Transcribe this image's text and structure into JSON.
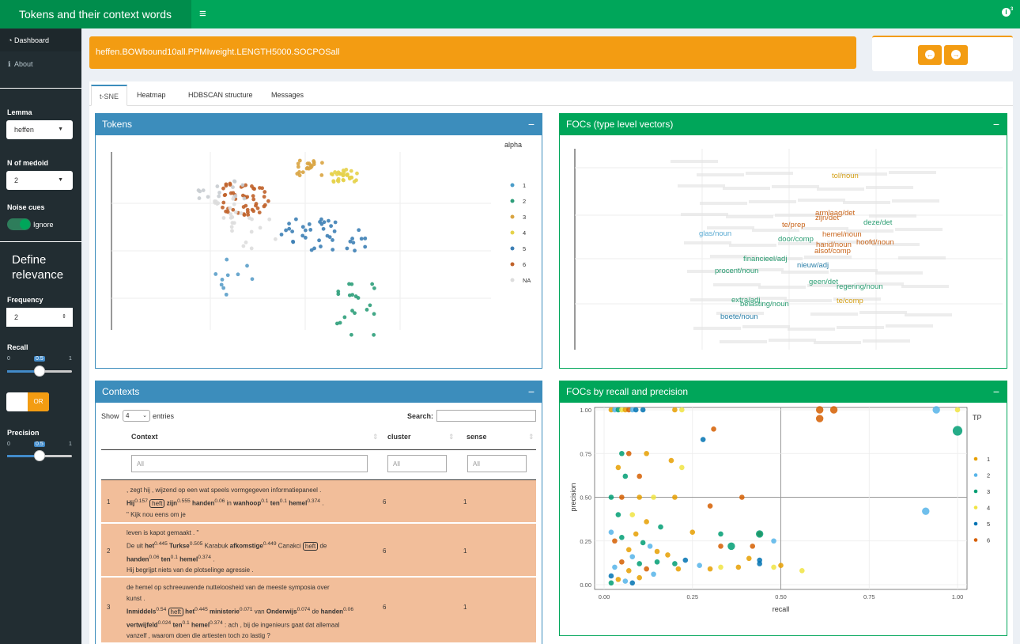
{
  "app_title": "Tokens and their context words",
  "sidebar": {
    "items": [
      {
        "label": "Dashboard",
        "icon": "dashboard-icon"
      },
      {
        "label": "About",
        "icon": "info-icon"
      }
    ],
    "lemma_label": "Lemma",
    "lemma_value": "heffen",
    "medoid_label": "N of medoid",
    "medoid_value": "2",
    "noise_label": "Noise cues",
    "noise_value": "Ignore",
    "define_label_1": "Define",
    "define_label_2": "relevance",
    "frequency_label": "Frequency",
    "frequency_value": "2",
    "recall_label": "Recall",
    "recall": {
      "min": "0",
      "max": "1",
      "value": "0.5"
    },
    "or_label": "OR",
    "precision_label": "Precision",
    "precision": {
      "min": "0",
      "max": "1",
      "value": "0.5"
    }
  },
  "model_name": "heffen.BOWbound10all.PPMIweight.LENGTH5000.SOCPOSall",
  "tabs": [
    "t-SNE",
    "Heatmap",
    "HDBSCAN structure",
    "Messages"
  ],
  "tokens_box": {
    "title": "Tokens",
    "legend_title": "alpha",
    "legend": [
      "1",
      "2",
      "3",
      "4",
      "5",
      "6",
      "NA"
    ]
  },
  "focs_box": {
    "title": "FOCs (type level vectors)",
    "labels": [
      {
        "text": "tol/noun",
        "color": "#d4a017"
      },
      {
        "text": "armlaag/det",
        "color": "#c8641a"
      },
      {
        "text": "zijn/det",
        "color": "#c8641a"
      },
      {
        "text": "deze/det",
        "color": "#2a9d72"
      },
      {
        "text": "te/prep",
        "color": "#c8641a"
      },
      {
        "text": "glas/noun",
        "color": "#5aaad2"
      },
      {
        "text": "hemel/noun",
        "color": "#c8641a"
      },
      {
        "text": "door/comp",
        "color": "#2a9d72"
      },
      {
        "text": "hoofd/noun",
        "color": "#c8641a"
      },
      {
        "text": "hand/noun",
        "color": "#c8641a"
      },
      {
        "text": "alsof/comp",
        "color": "#c8641a"
      },
      {
        "text": "financieel/adj",
        "color": "#2a9d72"
      },
      {
        "text": "nieuw/adj",
        "color": "#2a7fa8"
      },
      {
        "text": "procent/noun",
        "color": "#2a9d72"
      },
      {
        "text": "geen/det",
        "color": "#2a9d72"
      },
      {
        "text": "regering/noun",
        "color": "#2a9d72"
      },
      {
        "text": "te/comp",
        "color": "#d4a017"
      },
      {
        "text": "extra/adj",
        "color": "#2a9d72"
      },
      {
        "text": "belasting/noun",
        "color": "#2a9d72"
      },
      {
        "text": "boete/noun",
        "color": "#2a7fa8"
      }
    ]
  },
  "contexts_box": {
    "title": "Contexts",
    "show_label": "Show",
    "show_value": "4",
    "entries_label": "entries",
    "search_label": "Search:",
    "columns": [
      "Context",
      "cluster",
      "sense"
    ],
    "filter_placeholder": "All",
    "rows": [
      {
        "n": "1",
        "cluster": "6",
        "sense": "1",
        "l1": ", zegt hij , wijzend op een wat speels vormgegeven informatiepaneel .",
        "l2a": "Hij",
        "s2a": "0.157",
        "l2b": "heft",
        "l2c": "zijn",
        "s2c": "0.555",
        "l2d": "handen",
        "s2d": "0.06",
        "l2e": "in",
        "l2f": "wanhoop",
        "s2f": "0.1",
        "l2g": "ten",
        "s2g": "0.1",
        "l2h": "hemel",
        "s2h": "0.374",
        "l2i": ".",
        "l3": "\" Kijk nou eens om je"
      },
      {
        "n": "2",
        "cluster": "6",
        "sense": "1",
        "l1": "leven is kapot gemaakt . \"",
        "l2a": "De uit",
        "l2b": "het",
        "s2b": "0.445",
        "l2c": "Turkse",
        "s2c": "0.505",
        "l2d": "Karabuk",
        "l2e": "afkomstige",
        "s2e": "0.449",
        "l2f": "Canakci",
        "l2g": "heft",
        "l2h": "de",
        "l3a": "handen",
        "s3a": "0.06",
        "l3b": "ten",
        "s3b": "0.1",
        "l3c": "hemel",
        "s3c": "0.374",
        "l3d": ".",
        "l4": "Hij begrijpt niets van de plotselinge agressie ."
      },
      {
        "n": "3",
        "cluster": "6",
        "sense": "1",
        "l1": "de hemel op schreeuwende nutteloosheid van de meeste symposia over",
        "l2": "kunst .",
        "l3a": "Inmiddels",
        "s3a": "0.54",
        "l3b": "heft",
        "l3c": "het",
        "s3c": "0.445",
        "l3d": "ministerie",
        "s3d": "0.071",
        "l3e": "van",
        "l3f": "Onderwijs",
        "s3f": "0.074",
        "l3g": "de",
        "l3h": "handen",
        "s3h": "0.06",
        "l4a": "vertwijfeld",
        "s4a": "0.024",
        "l4b": "ten",
        "s4b": "0.1",
        "l4c": "hemel",
        "s4c": "0.374",
        "l4d": ": ach , bij de ingenieurs gaat dat allemaal",
        "l5": "vanzelf , waarom doen die artiesten toch zo lastig ?"
      }
    ]
  },
  "recall_box": {
    "title": "FOCs by recall and precision"
  },
  "chart_data": {
    "type": "scatter",
    "xlabel": "recall",
    "ylabel": "precision",
    "xlim": [
      0,
      1
    ],
    "ylim": [
      0,
      1
    ],
    "xticks": [
      "0.00",
      "0.25",
      "0.50",
      "0.75",
      "1.00"
    ],
    "yticks": [
      "0.00",
      "0.25",
      "0.50",
      "0.75",
      "1.00"
    ],
    "legend_title": "TP",
    "legend": [
      "1",
      "2",
      "3",
      "4",
      "5",
      "6"
    ],
    "colors": [
      "#e69f00",
      "#56b4e9",
      "#009e73",
      "#f0e442",
      "#0072b2",
      "#d55e00"
    ],
    "points": [
      [
        0.02,
        1,
        2,
        1
      ],
      [
        0.03,
        1,
        2,
        2
      ],
      [
        0.04,
        1,
        2,
        3
      ],
      [
        0.05,
        1,
        2,
        4
      ],
      [
        0.06,
        1,
        2,
        1
      ],
      [
        0.07,
        1,
        2,
        6
      ],
      [
        0.08,
        1,
        2,
        2
      ],
      [
        0.09,
        1,
        2,
        5
      ],
      [
        0.11,
        1,
        2,
        5
      ],
      [
        0.2,
        1,
        2,
        1
      ],
      [
        0.22,
        1,
        2,
        4
      ],
      [
        0.61,
        1,
        3,
        6
      ],
      [
        0.65,
        1,
        3,
        6
      ],
      [
        0.61,
        0.95,
        3,
        6
      ],
      [
        0.94,
        1,
        3,
        2
      ],
      [
        1,
        1,
        2,
        4
      ],
      [
        1,
        0.88,
        4,
        3
      ],
      [
        0.31,
        0.89,
        2,
        6
      ],
      [
        0.28,
        0.83,
        2,
        5
      ],
      [
        0.05,
        0.75,
        2,
        3
      ],
      [
        0.07,
        0.75,
        2,
        6
      ],
      [
        0.12,
        0.75,
        2,
        1
      ],
      [
        0.19,
        0.71,
        2,
        1
      ],
      [
        0.22,
        0.67,
        2,
        4
      ],
      [
        0.04,
        0.67,
        2,
        1
      ],
      [
        0.06,
        0.62,
        2,
        3
      ],
      [
        0.1,
        0.62,
        2,
        6
      ],
      [
        0.02,
        0.5,
        2,
        3
      ],
      [
        0.05,
        0.5,
        2,
        6
      ],
      [
        0.1,
        0.5,
        2,
        1
      ],
      [
        0.14,
        0.5,
        2,
        4
      ],
      [
        0.2,
        0.5,
        2,
        1
      ],
      [
        0.3,
        0.45,
        2,
        6
      ],
      [
        0.39,
        0.5,
        2,
        6
      ],
      [
        0.91,
        0.42,
        3,
        2
      ],
      [
        0.04,
        0.4,
        2,
        3
      ],
      [
        0.08,
        0.4,
        2,
        4
      ],
      [
        0.12,
        0.36,
        2,
        1
      ],
      [
        0.16,
        0.33,
        2,
        3
      ],
      [
        0.25,
        0.3,
        2,
        1
      ],
      [
        0.33,
        0.29,
        2,
        3
      ],
      [
        0.44,
        0.29,
        2,
        6
      ],
      [
        0.44,
        0.29,
        3,
        3
      ],
      [
        0.33,
        0.22,
        2,
        6
      ],
      [
        0.36,
        0.22,
        3,
        3
      ],
      [
        0.48,
        0.25,
        2,
        2
      ],
      [
        0.42,
        0.22,
        2,
        6
      ],
      [
        0.02,
        0.3,
        2,
        2
      ],
      [
        0.03,
        0.25,
        2,
        6
      ],
      [
        0.05,
        0.27,
        2,
        3
      ],
      [
        0.07,
        0.2,
        2,
        1
      ],
      [
        0.09,
        0.29,
        2,
        1
      ],
      [
        0.11,
        0.24,
        2,
        3
      ],
      [
        0.13,
        0.22,
        2,
        2
      ],
      [
        0.15,
        0.19,
        2,
        1
      ],
      [
        0.18,
        0.17,
        2,
        1
      ],
      [
        0.2,
        0.12,
        2,
        3
      ],
      [
        0.23,
        0.14,
        2,
        5
      ],
      [
        0.27,
        0.11,
        2,
        2
      ],
      [
        0.3,
        0.09,
        2,
        1
      ],
      [
        0.33,
        0.1,
        2,
        4
      ],
      [
        0.38,
        0.1,
        2,
        1
      ],
      [
        0.44,
        0.12,
        2,
        5
      ],
      [
        0.44,
        0.14,
        2,
        5
      ],
      [
        0.48,
        0.1,
        2,
        4
      ],
      [
        0.5,
        0.11,
        2,
        1
      ],
      [
        0.56,
        0.08,
        2,
        4
      ],
      [
        0.41,
        0.15,
        2,
        1
      ],
      [
        0.02,
        0.05,
        2,
        5
      ],
      [
        0.03,
        0.1,
        2,
        2
      ],
      [
        0.05,
        0.13,
        2,
        6
      ],
      [
        0.07,
        0.08,
        2,
        1
      ],
      [
        0.08,
        0.16,
        2,
        2
      ],
      [
        0.1,
        0.12,
        2,
        3
      ],
      [
        0.12,
        0.09,
        2,
        6
      ],
      [
        0.14,
        0.06,
        2,
        2
      ],
      [
        0.15,
        0.13,
        2,
        3
      ],
      [
        0.21,
        0.09,
        2,
        1
      ],
      [
        0.02,
        0.01,
        2,
        3
      ],
      [
        0.04,
        0.03,
        2,
        1
      ],
      [
        0.06,
        0.02,
        2,
        2
      ],
      [
        0.08,
        0.01,
        2,
        5
      ],
      [
        0.1,
        0.04,
        2,
        1
      ]
    ]
  }
}
